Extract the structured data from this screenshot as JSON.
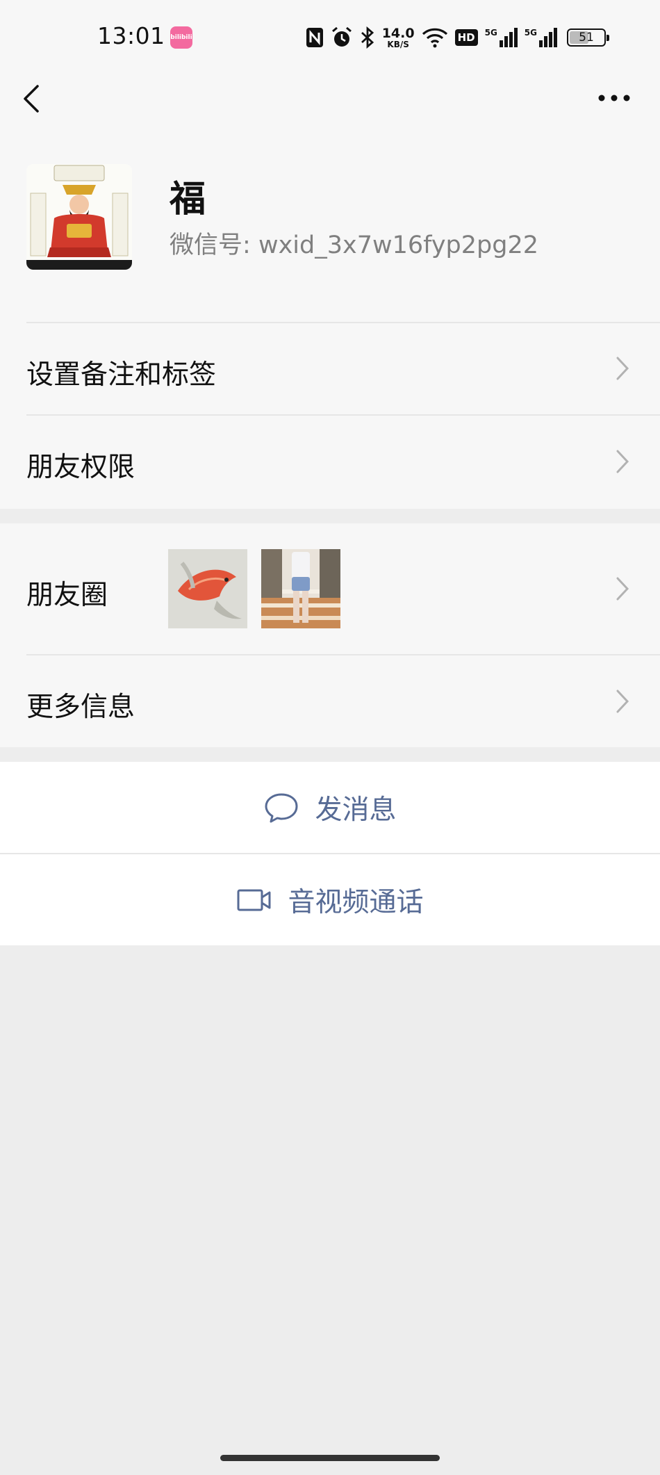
{
  "status_bar": {
    "time": "13:01",
    "app_badge": "bilibili",
    "net_speed_value": "14.0",
    "net_speed_unit": "KB/S",
    "hd_label": "HD",
    "sig1_label": "5G",
    "sig2_label": "5G",
    "battery_level": "51",
    "icons": [
      "nfc-icon",
      "alarm-icon",
      "bluetooth-icon",
      "wifi-icon"
    ]
  },
  "nav": {
    "back_icon": "chevron-left-icon",
    "more_icon": "more-dots-icon"
  },
  "profile": {
    "name": "福",
    "wxid_label": "微信号:",
    "wxid_value": "wxid_3x7w16fyp2pg22"
  },
  "menu": {
    "remark_tags": "设置备注和标签",
    "friend_permissions": "朋友权限",
    "moments": "朋友圈",
    "more_info": "更多信息"
  },
  "actions": {
    "send_message": "发消息",
    "av_call": "音视频通话"
  },
  "colors": {
    "link_blue": "#576b95",
    "page_bg": "#ededed",
    "section_bg": "#f7f7f7"
  }
}
